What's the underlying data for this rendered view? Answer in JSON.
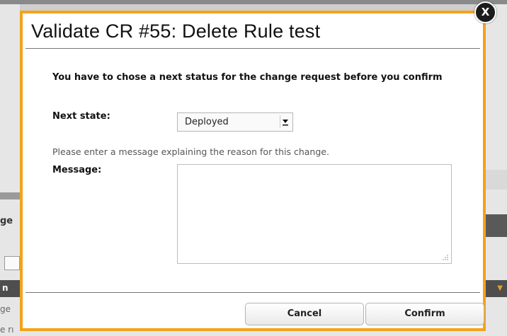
{
  "background": {
    "left_fragments": [
      "ge",
      "",
      "n",
      "ge",
      "e rı"
    ],
    "right_marker": "▼"
  },
  "dialog": {
    "title": "Validate CR #55: Delete Rule test",
    "instruction": "You have to chose a next status for the change request before you confirm",
    "next_state_label": "Next state:",
    "next_state_value": "Deployed",
    "help_text": "Please enter a message explaining the reason for this change.",
    "message_label": "Message:",
    "message_value": "",
    "cancel_label": "Cancel",
    "confirm_label": "Confirm",
    "close_label": "X"
  },
  "colors": {
    "accent": "#f5a21b",
    "overlay": "#cfcfcf"
  }
}
